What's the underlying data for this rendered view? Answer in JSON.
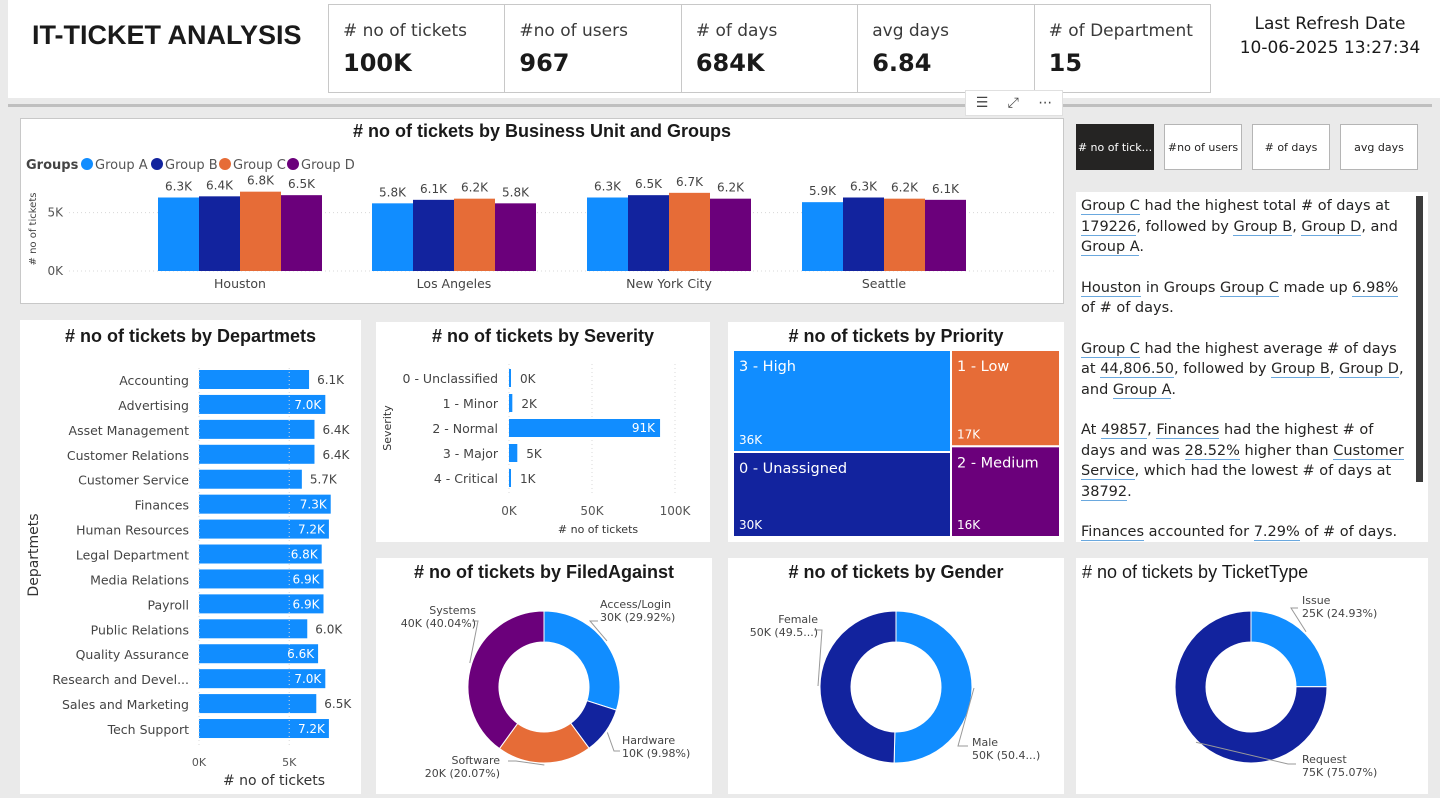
{
  "header": {
    "title": "IT-TICKET ANALYSIS",
    "kpis": [
      {
        "label": "# no of tickets",
        "value": "100K"
      },
      {
        "label": "#no of users",
        "value": "967"
      },
      {
        "label": "# of days",
        "value": "684K"
      },
      {
        "label": "avg days",
        "value": "6.84"
      },
      {
        "label": "# of Department",
        "value": "15"
      }
    ],
    "refresh_label": "Last Refresh Date",
    "refresh_value": "10-06-2025 13:27:34"
  },
  "visual_header_icons": [
    "filter-icon",
    "focus-mode-icon",
    "more-options-icon"
  ],
  "colors": {
    "groupA": "#118DFF",
    "groupB": "#12239E",
    "groupC": "#E66C37",
    "groupD": "#6B007B"
  },
  "slicer": {
    "buttons": [
      "# no of tick...",
      "#no of users",
      "# of days",
      "avg days"
    ],
    "active_index": 0
  },
  "narrative": [
    [
      {
        "t": "Group C",
        "u": true
      },
      {
        "t": " had the highest total # of days at "
      },
      {
        "t": "179226",
        "u": true
      },
      {
        "t": ", followed by "
      },
      {
        "t": "Group B",
        "u": true
      },
      {
        "t": ", "
      },
      {
        "t": "Group D",
        "u": true
      },
      {
        "t": ", and "
      },
      {
        "t": "Group A",
        "u": true
      },
      {
        "t": "."
      }
    ],
    [
      {
        "t": "Houston",
        "u": true
      },
      {
        "t": " in Groups "
      },
      {
        "t": "Group C",
        "u": true
      },
      {
        "t": " made up "
      },
      {
        "t": "6.98%",
        "u": true
      },
      {
        "t": " of # of days."
      }
    ],
    [
      {
        "t": "Group C",
        "u": true
      },
      {
        "t": " had the highest average # of days at "
      },
      {
        "t": "44,806.50",
        "u": true
      },
      {
        "t": ", followed by "
      },
      {
        "t": "Group B",
        "u": true
      },
      {
        "t": ", "
      },
      {
        "t": "Group D",
        "u": true
      },
      {
        "t": ", and "
      },
      {
        "t": "Group A",
        "u": true
      },
      {
        "t": "."
      }
    ],
    [
      {
        "t": "At "
      },
      {
        "t": "49857",
        "u": true
      },
      {
        "t": ", "
      },
      {
        "t": "Finances",
        "u": true
      },
      {
        "t": " had the highest # of days and was "
      },
      {
        "t": "28.52%",
        "u": true
      },
      {
        "t": " higher than "
      },
      {
        "t": "Customer Service",
        "u": true
      },
      {
        "t": ", which had the lowest # of days at "
      },
      {
        "t": "38792",
        "u": true
      },
      {
        "t": "."
      }
    ],
    [
      {
        "t": "Finances",
        "u": true
      },
      {
        "t": " accounted for "
      },
      {
        "t": "7.29%",
        "u": true
      },
      {
        "t": " of # of days."
      }
    ],
    [
      {
        "t": "Across all 5 Severity, # of days ranged from 1492"
      }
    ]
  ],
  "chart_data": [
    {
      "id": "business_unit",
      "type": "bar",
      "title": "# no of tickets by Business Unit and Groups",
      "legend_title": "Groups",
      "legend_position": "top-left",
      "categories": [
        "Houston",
        "Los Angeles",
        "New York City",
        "Seattle"
      ],
      "series": [
        {
          "name": "Group A",
          "values": [
            6300,
            5800,
            6300,
            5900
          ],
          "labels": [
            "6.3K",
            "5.8K",
            "6.3K",
            "5.9K"
          ]
        },
        {
          "name": "Group B",
          "values": [
            6400,
            6100,
            6500,
            6300
          ],
          "labels": [
            "6.4K",
            "6.1K",
            "6.5K",
            "6.3K"
          ]
        },
        {
          "name": "Group C",
          "values": [
            6800,
            6200,
            6700,
            6200
          ],
          "labels": [
            "6.8K",
            "6.2K",
            "6.7K",
            "6.2K"
          ]
        },
        {
          "name": "Group D",
          "values": [
            6500,
            5800,
            6200,
            6100
          ],
          "labels": [
            "6.5K",
            "5.8K",
            "6.2K",
            "6.1K"
          ]
        }
      ],
      "ylabel": "# no of tickets",
      "yticks": [
        "0K",
        "5K"
      ],
      "ylim": [
        0,
        9000
      ],
      "grid": true
    },
    {
      "id": "departments",
      "type": "bar",
      "orientation": "horizontal",
      "title": "# no of tickets by Departmets",
      "categories": [
        "Accounting",
        "Advertising",
        "Asset Management",
        "Customer Relations",
        "Customer Service",
        "Finances",
        "Human Resources",
        "Legal Department",
        "Media Relations",
        "Payroll",
        "Public Relations",
        "Quality Assurance",
        "Research and Devel...",
        "Sales and Marketing",
        "Tech Support"
      ],
      "values": [
        6100,
        7000,
        6400,
        6400,
        5700,
        7300,
        7200,
        6800,
        6900,
        6900,
        6000,
        6600,
        7000,
        6500,
        7200
      ],
      "labels": [
        "6.1K",
        "7.0K",
        "6.4K",
        "6.4K",
        "5.7K",
        "7.3K",
        "7.2K",
        "6.8K",
        "6.9K",
        "6.9K",
        "6.0K",
        "6.6K",
        "7.0K",
        "6.5K",
        "7.2K"
      ],
      "xlabel": "# no of tickets",
      "ylabel": "Departmets",
      "xticks": [
        "0K",
        "5K"
      ],
      "xlim": [
        0,
        9200
      ]
    },
    {
      "id": "severity",
      "type": "bar",
      "orientation": "horizontal",
      "title": "# no of tickets by Severity",
      "categories": [
        "0 - Unclassified",
        "1 - Minor",
        "2 - Normal",
        "3 - Major",
        "4 - Critical"
      ],
      "values": [
        200,
        2000,
        91000,
        5000,
        1000
      ],
      "labels": [
        "0K",
        "2K",
        "91K",
        "5K",
        "1K"
      ],
      "xlabel": "# no of tickets",
      "ylabel": "Severity",
      "xticks": [
        "0K",
        "50K",
        "100K"
      ],
      "xlim": [
        0,
        100000
      ]
    },
    {
      "id": "priority",
      "type": "treemap",
      "title": "# no of tickets by Priority",
      "items": [
        {
          "name": "3 - High",
          "value": 36000,
          "label": "36K",
          "color": "#118DFF"
        },
        {
          "name": "0 - Unassigned",
          "value": 30000,
          "label": "30K",
          "color": "#12239E"
        },
        {
          "name": "1 - Low",
          "value": 17000,
          "label": "17K",
          "color": "#E66C37"
        },
        {
          "name": "2 - Medium",
          "value": 16000,
          "label": "16K",
          "color": "#6B007B"
        }
      ]
    },
    {
      "id": "filed_against",
      "type": "pie",
      "donut": true,
      "title": "# no of tickets by FiledAgainst",
      "slices": [
        {
          "name": "Access/Login",
          "value": 29.92,
          "label": "30K (29.92%)",
          "color": "#118DFF"
        },
        {
          "name": "Hardware",
          "value": 9.98,
          "label": "10K (9.98%)",
          "color": "#12239E"
        },
        {
          "name": "Software",
          "value": 20.07,
          "label": "20K (20.07%)",
          "color": "#E66C37"
        },
        {
          "name": "Systems",
          "value": 40.04,
          "label": "40K (40.04%)",
          "color": "#6B007B"
        }
      ]
    },
    {
      "id": "gender",
      "type": "pie",
      "donut": true,
      "title": "# no of tickets by Gender",
      "slices": [
        {
          "name": "Male",
          "value": 50.4,
          "label": "50K (50.4...)",
          "color": "#118DFF"
        },
        {
          "name": "Female",
          "value": 49.6,
          "label": "50K (49.5...)",
          "color": "#12239E"
        }
      ]
    },
    {
      "id": "ticket_type",
      "type": "pie",
      "donut": true,
      "title": "# no of tickets by TicketType",
      "slices": [
        {
          "name": "Issue",
          "value": 24.93,
          "label": "25K (24.93%)",
          "color": "#118DFF"
        },
        {
          "name": "Request",
          "value": 75.07,
          "label": "75K (75.07%)",
          "color": "#12239E"
        }
      ]
    }
  ]
}
